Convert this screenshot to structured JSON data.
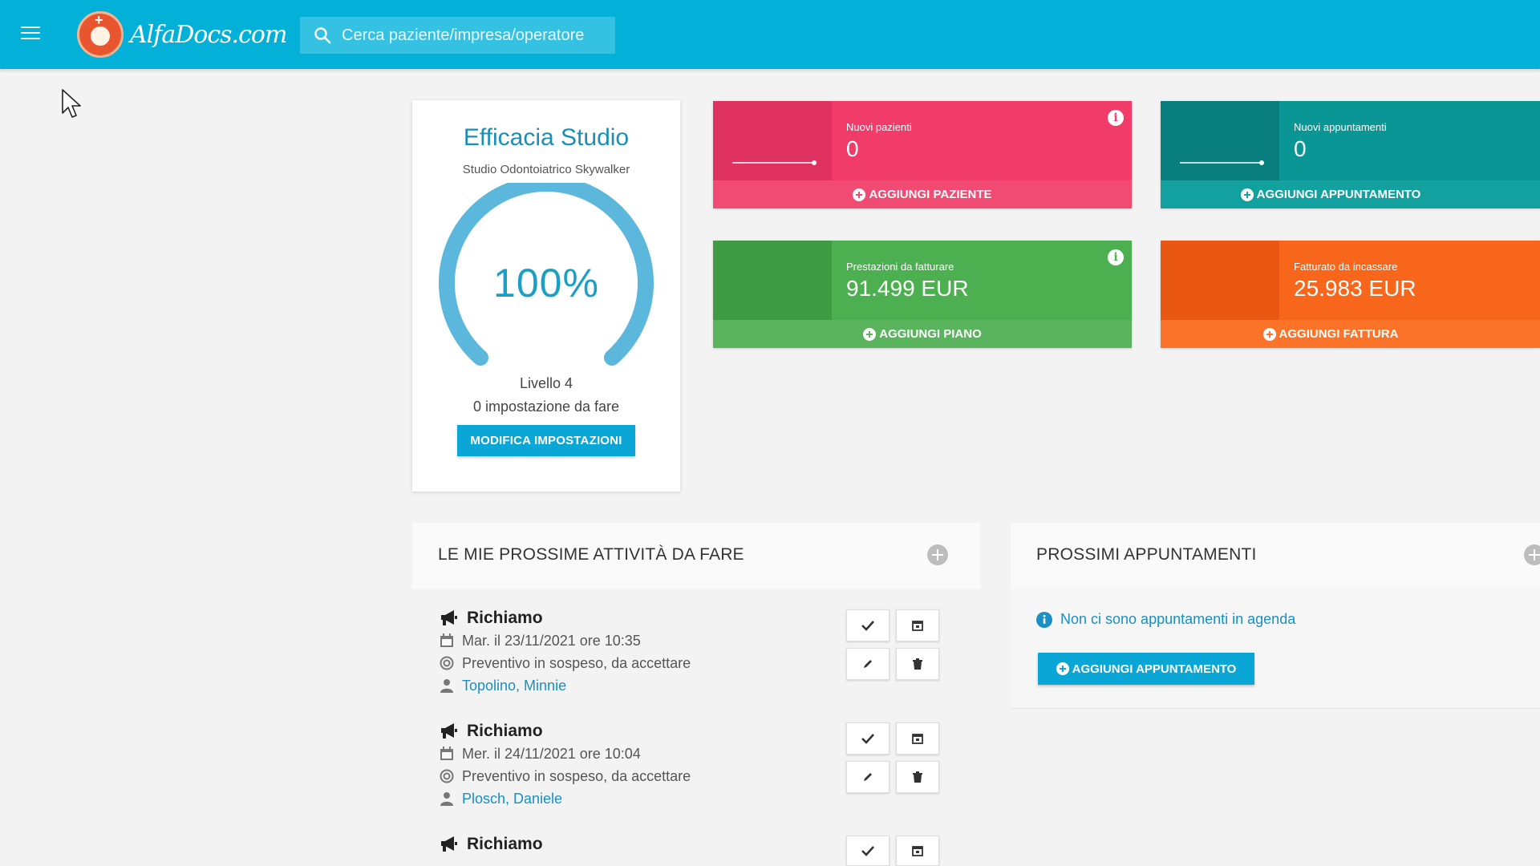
{
  "topbar": {
    "menu_icon": "hamburger-icon",
    "logo_text": "AlfaDocs.com",
    "search_placeholder": "Cerca paziente/impresa/operatore",
    "bg_color": "#03b1d8"
  },
  "efficacia": {
    "title": "Efficacia Studio",
    "subtitle": "Studio Odontoiatrico Skywalker",
    "percent": "100%",
    "level": "Livello 4",
    "todo": "0 impostazione da fare",
    "button_label": "MODIFICA IMPOSTAZIONI"
  },
  "stats": [
    {
      "label": "Nuovi pazienti",
      "value": "0",
      "action": "AGGIUNGI PAZIENTE",
      "color_main": "#f13c6a",
      "color_side": "#df3260",
      "color_foot": "#f14b74",
      "info": true
    },
    {
      "label": "Nuovi appuntamenti",
      "value": "0",
      "action": "AGGIUNGI APPUNTAMENTO",
      "color_main": "#0a9694",
      "color_side": "#087f7e",
      "color_foot": "#13a19f",
      "info": false
    },
    {
      "label": "Prestazioni da fatturare",
      "value": "91.499 EUR",
      "action": "AGGIUNGI PIANO",
      "color_main": "#4caf50",
      "color_side": "#3f9b43",
      "color_foot": "#59b45d",
      "info": true
    },
    {
      "label": "Fatturato da incassare",
      "value": "25.983 EUR",
      "action": "AGGIUNGI FATTURA",
      "color_main": "#f8661c",
      "color_side": "#ea5712",
      "color_foot": "#fb7329",
      "info": false
    }
  ],
  "tasks_section": {
    "title": "LE MIE PROSSIME ATTIVITÀ DA FARE",
    "items": [
      {
        "title": "Richiamo",
        "date": "Mar. il 23/11/2021 ore 10:35",
        "status": "Preventivo in sospeso, da accettare",
        "patient": "Topolino, Minnie"
      },
      {
        "title": "Richiamo",
        "date": "Mer. il 24/11/2021 ore 10:04",
        "status": "Preventivo in sospeso, da accettare",
        "patient": "Plosch, Daniele"
      },
      {
        "title": "Richiamo",
        "date": "",
        "status": "",
        "patient": ""
      }
    ]
  },
  "appointments_section": {
    "title": "PROSSIMI APPUNTAMENTI",
    "empty_message": "Non ci sono appuntamenti in agenda",
    "button_label": "AGGIUNGI APPUNTAMENTO"
  }
}
